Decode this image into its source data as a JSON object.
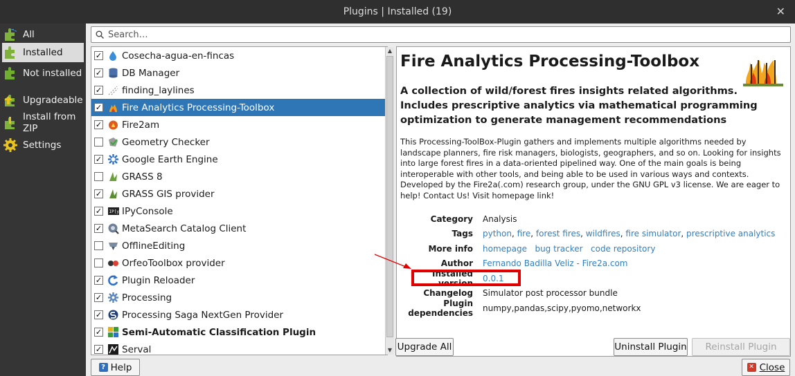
{
  "window": {
    "title": "Plugins | Installed (19)"
  },
  "sidebar": {
    "items": [
      {
        "label": "All",
        "icon": "puzzle-all-icon"
      },
      {
        "label": "Installed",
        "icon": "puzzle-installed-icon",
        "active": true
      },
      {
        "label": "Not installed",
        "icon": "puzzle-not-installed-icon"
      },
      {
        "label": "Upgradeable",
        "icon": "puzzle-upgradeable-icon"
      },
      {
        "label": "Install from ZIP",
        "icon": "puzzle-zip-icon"
      },
      {
        "label": "Settings",
        "icon": "gear-icon"
      }
    ]
  },
  "search": {
    "placeholder": "Search…"
  },
  "plugins": [
    {
      "name": "Cosecha-agua-en-fincas",
      "checked": true
    },
    {
      "name": "DB Manager",
      "checked": true
    },
    {
      "name": "finding_laylines",
      "checked": true
    },
    {
      "name": "Fire Analytics Processing-Toolbox",
      "checked": true,
      "selected": true
    },
    {
      "name": "Fire2am",
      "checked": true
    },
    {
      "name": "Geometry Checker",
      "checked": false
    },
    {
      "name": "Google Earth Engine",
      "checked": true
    },
    {
      "name": "GRASS 8",
      "checked": false
    },
    {
      "name": "GRASS GIS provider",
      "checked": true
    },
    {
      "name": "IPyConsole",
      "checked": true
    },
    {
      "name": "MetaSearch Catalog Client",
      "checked": true
    },
    {
      "name": "OfflineEditing",
      "checked": false
    },
    {
      "name": "OrfeoToolbox provider",
      "checked": false
    },
    {
      "name": "Plugin Reloader",
      "checked": true
    },
    {
      "name": "Processing",
      "checked": true
    },
    {
      "name": "Processing Saga NextGen Provider",
      "checked": true
    },
    {
      "name": "Semi-Automatic Classification Plugin",
      "checked": true,
      "bold": true
    },
    {
      "name": "Serval",
      "checked": true
    }
  ],
  "details": {
    "title": "Fire Analytics Processing-Toolbox",
    "summary": "A collection of wild/forest fires insights related algorithms. Includes prescriptive analytics via mathematical programming optimization to generate management recommendations",
    "description": "This Processing-ToolBox-Plugin gathers and implements multiple algorithms needed by landscape planners, fire risk managers, biologists, geographers, and so on. Looking for insights into large forest fires in a data-oriented pipelined way. One of the main goals is being interoperable with other tools, and being able to be used in various ways and contexts. Developed by the Fire2a(.com) research group, under the GNU GPL v3 license. We are eager to help! Contact Us! Visit homepage link!",
    "category_label": "Category",
    "category": "Analysis",
    "tags_label": "Tags",
    "tags": [
      "python",
      "fire",
      "forest fires",
      "wildfires",
      "fire simulator",
      "prescriptive analytics"
    ],
    "more_info_label": "More info",
    "more_info": [
      "homepage",
      "bug tracker",
      "code repository"
    ],
    "author_label": "Author",
    "author": "Fernando Badilla Veliz - Fire2a.com",
    "installed_version_label": "Installed version",
    "installed_version": "0.0.1",
    "changelog_label": "Changelog",
    "changelog": "Simulator post processor bundle",
    "dependencies_label": "Plugin dependencies",
    "dependencies": "numpy,pandas,scipy,pyomo,networkx"
  },
  "buttons": {
    "upgrade_all": "Upgrade All",
    "uninstall": "Uninstall Plugin",
    "reinstall": "Reinstall Plugin",
    "help": "Help",
    "close": "Close"
  },
  "colors": {
    "selection": "#2f76b6",
    "link": "#2f7fc1",
    "annotation": "#e10000"
  }
}
